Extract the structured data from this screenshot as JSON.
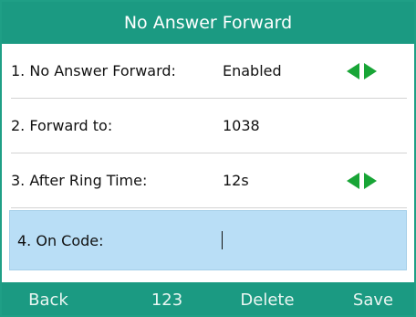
{
  "header": {
    "title": "No Answer Forward"
  },
  "rows": [
    {
      "label": "1. No Answer Forward:",
      "value": "Enabled"
    },
    {
      "label": "2. Forward to:",
      "value": "1038"
    },
    {
      "label": "3. After Ring Time:",
      "value": "12s"
    },
    {
      "label": "4. On Code:",
      "value": ""
    }
  ],
  "softkeys": [
    "Back",
    "123",
    "Delete",
    "Save"
  ],
  "colors": {
    "accent": "#1b9a82",
    "arrow": "#18a536",
    "selection": "#b9def6"
  }
}
